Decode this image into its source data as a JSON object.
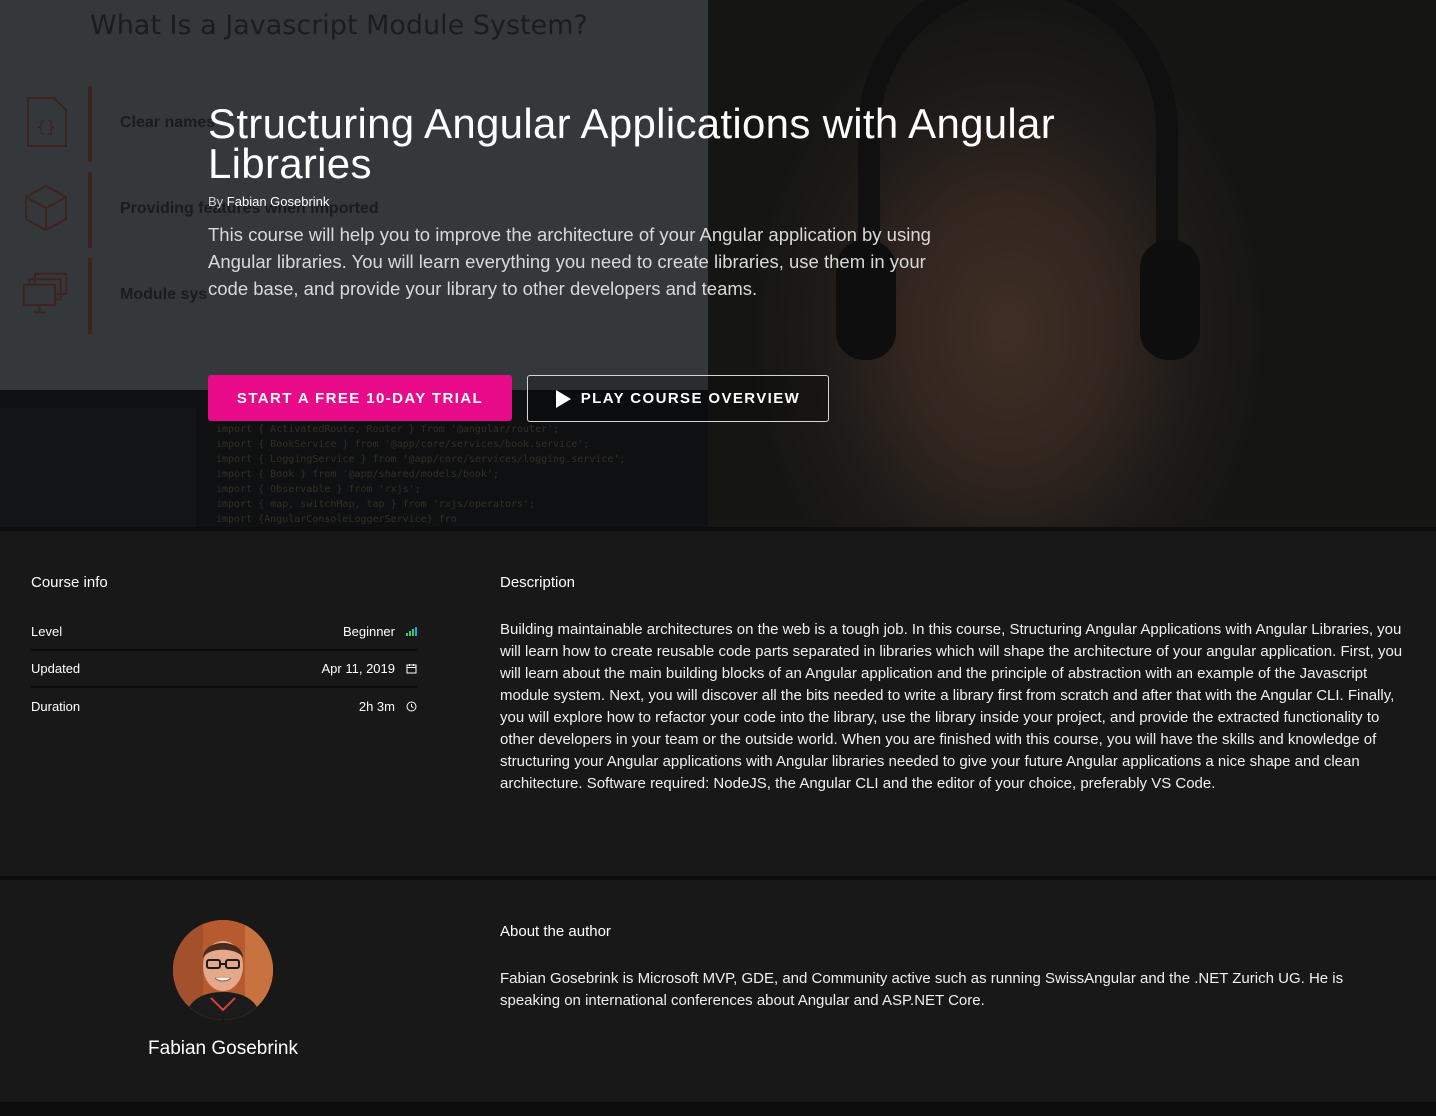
{
  "hero": {
    "background_slide_title": "What Is a Javascript Module System?",
    "background_slide_items": [
      "Clear names",
      "Providing features when imported",
      "Module sys"
    ],
    "background_code_lines": [
      "import { ActivatedRoute, Router } from '@angular/router';",
      "import { BookService } from '@app/core/services/book.service';",
      "import { LoggingService } from '@app/core/services/logging.service';",
      "import { Book } from '@app/shared/models/book';",
      "import { Observable } from 'rxjs';",
      "import { map, switchMap, tap } from 'rxjs/operators';",
      "import {AngularConsoleLoggerService} fro"
    ],
    "title": "Structuring Angular Applications with Angular Libraries",
    "by_label": "By",
    "author": "Fabian Gosebrink",
    "description": "This course will help you to improve the architecture of your Angular application by using Angular libraries. You will learn everything you need to create libraries, use them in your code base, and provide your library to other developers and teams.",
    "primary_button": "START A FREE 10-DAY TRIAL",
    "secondary_button": "PLAY COURSE OVERVIEW",
    "accent_color": "#e80a89"
  },
  "course_info": {
    "heading": "Course info",
    "rows": [
      {
        "label": "Level",
        "value": "Beginner",
        "icon": "level-bars-icon"
      },
      {
        "label": "Updated",
        "value": "Apr 11, 2019",
        "icon": "calendar-icon"
      },
      {
        "label": "Duration",
        "value": "2h 3m",
        "icon": "clock-icon"
      }
    ],
    "level_icon_colors": [
      "#2fd05c",
      "#2fd05c",
      "#2fd05c",
      "#1aa4e0"
    ]
  },
  "description": {
    "heading": "Description",
    "text": "Building maintainable architectures on the web is a tough job. In this course, Structuring Angular Applications with Angular Libraries, you will learn how to create reusable code parts separated in libraries which will shape the architecture of your angular application. First, you will learn about the main building blocks of an Angular application and the principle of abstraction with an example of the Javascript module system. Next, you will discover all the bits needed to write a library first from scratch and after that with the Angular CLI. Finally, you will explore how to refactor your code into the library, use the library inside your project, and provide the extracted functionality to other developers in your team or the outside world. When you are finished with this course, you will have the skills and knowledge of structuring your Angular applications with Angular libraries needed to give your future Angular applications a nice shape and clean architecture. Software required: NodeJS, the Angular CLI and the editor of your choice, preferably VS Code."
  },
  "author_section": {
    "heading": "About the author",
    "name": "Fabian Gosebrink",
    "bio": "Fabian Gosebrink is Microsoft MVP, GDE, and Community active such as running SwissAngular and the .NET Zurich UG. He is speaking on international conferences about Angular and ASP.NET Core."
  }
}
